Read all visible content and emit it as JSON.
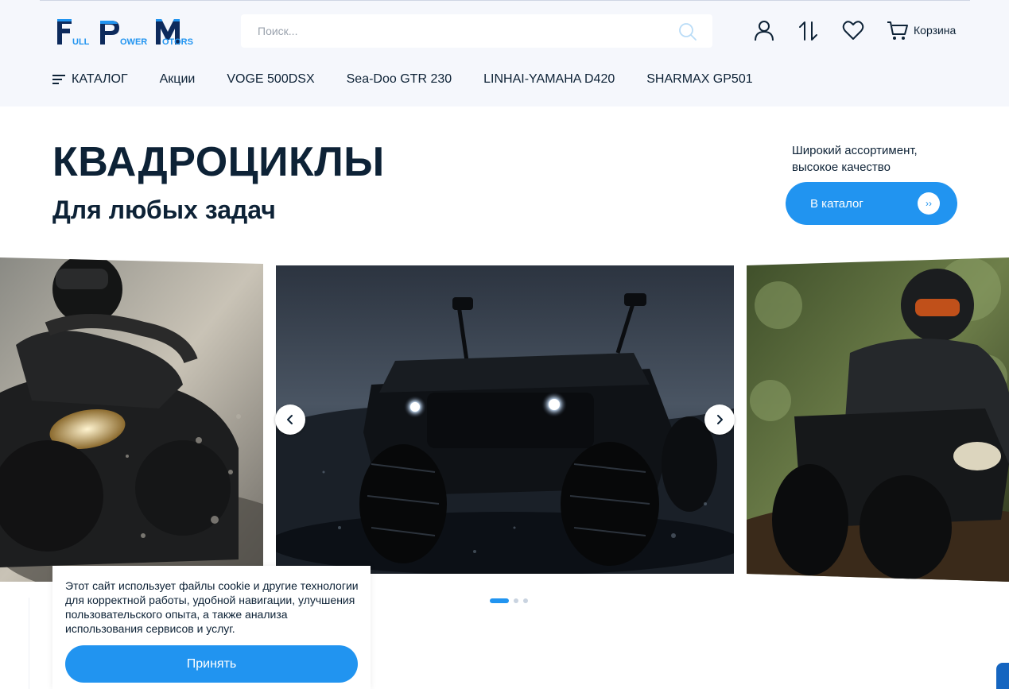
{
  "header": {
    "logo": {
      "letters": [
        "F",
        "P",
        "M"
      ],
      "words": [
        "ULL",
        "OWER",
        "OTORS"
      ],
      "alt": "Full Power Motors"
    },
    "search": {
      "placeholder": "Поиск...",
      "value": ""
    },
    "icons": [
      "user-icon",
      "compare-icon",
      "heart-icon",
      "cart-icon"
    ],
    "cart_label": "Корзина"
  },
  "nav": {
    "catalog_label": "КАТАЛОГ",
    "items": [
      "Акции",
      "VOGE 500DSX",
      "Sea-Doo GTR 230",
      "LINHAI-YAMAHA D420",
      "SHARMAX GP501"
    ]
  },
  "hero": {
    "title": "КВАДРОЦИКЛЫ",
    "subtitle": "Для любых задач",
    "right_text": "Широкий ассортимент, высокое качество",
    "cta_label": "В каталог",
    "cta_arrow": "››"
  },
  "slider": {
    "prev_icon": "chevron-left-icon",
    "next_icon": "chevron-right-icon",
    "slides": 3,
    "active_slide": 1
  },
  "cookie": {
    "text": "Этот сайт использует файлы cookie и другие технологии для корректной работы, удобной навигации, улучшения пользовательского опыта, а также анализа использования сервисов и услуг.",
    "button_label": "Принять"
  },
  "colors": {
    "accent": "#2194f0",
    "text": "#0d2236",
    "header_bg": "#f5f7fc",
    "logo_dark": "#0d2a5c"
  }
}
